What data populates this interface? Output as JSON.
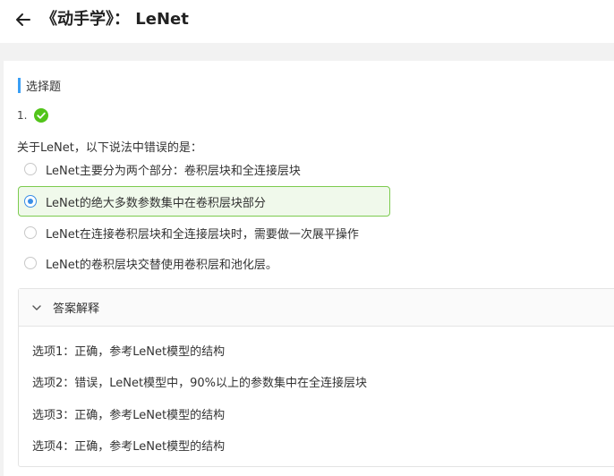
{
  "header": {
    "title": "《动手学》： LeNet"
  },
  "section": {
    "label": "选择题"
  },
  "question": {
    "number": "1.",
    "stem": "关于LeNet，以下说法中错误的是：",
    "options": [
      {
        "text": "LeNet主要分为两个部分：卷积层块和全连接层块",
        "selected": false
      },
      {
        "text": "LeNet的绝大多数参数集中在卷积层块部分",
        "selected": true
      },
      {
        "text": "LeNet在连接卷积层块和全连接层块时，需要做一次展平操作",
        "selected": false
      },
      {
        "text": "LeNet的卷积层块交替使用卷积层和池化层。",
        "selected": false
      }
    ]
  },
  "explanation": {
    "title": "答案解释",
    "lines": [
      "选项1：正确，参考LeNet模型的结构",
      "选项2：错误，LeNet模型中，90%以上的参数集中在全连接层块",
      "选项3：正确，参考LeNet模型的结构",
      "选项4：正确，参考LeNet模型的结构"
    ]
  },
  "colors": {
    "accent": "#3a9ff5",
    "correct_green": "#52c41a",
    "selected_bg": "#f0f9eb",
    "selected_border": "#7ccb4f"
  },
  "icons": [
    "back-arrow-icon",
    "check-circle-icon",
    "chevron-down-icon"
  ]
}
